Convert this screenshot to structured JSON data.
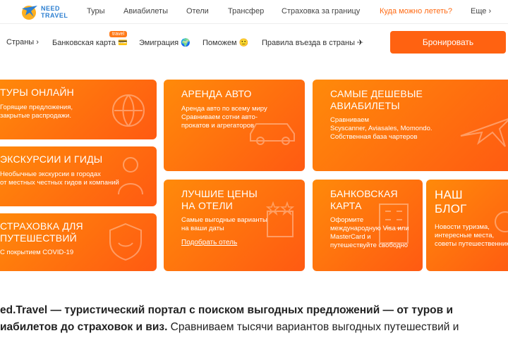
{
  "logo": {
    "text_line1": "NEED",
    "text_line2": "TRAVEL"
  },
  "topnav": {
    "items": [
      "Туры",
      "Авиабилеты",
      "Отели",
      "Трансфер",
      "Страховка за границу",
      "Куда можно лететь?",
      "Еще ›"
    ]
  },
  "subnav": {
    "items": [
      "Страны ›",
      "Банковская карта 💳",
      "Эмиграция 🌍",
      "Поможем 🙂",
      "Правила въезда в страны ✈"
    ],
    "badge": "travel",
    "book_button": "Бронировать"
  },
  "tiles": {
    "tours": {
      "title": "ТУРЫ ОНЛАЙН",
      "desc": "Горящие предложения,\nзакрытые распродажи."
    },
    "cars": {
      "title": "АРЕНДА АВТО",
      "desc": "Аренда авто по всему миру\nСравниваем сотни авто-\nпрокатов и агрегаторов"
    },
    "flights": {
      "title": "САМЫЕ ДЕШЕВЫЕ\nАВИАБИЛЕТЫ",
      "desc": "Сравниваем\nScyscanner, Aviasales, Momondo.\nСобственная база чартеров"
    },
    "excursions": {
      "title": "ЭКСКУРСИИ И ГИДЫ",
      "desc": "Необычные экскурсии в городах\nот местных честных гидов и компаний"
    },
    "hotels": {
      "title": "ЛУЧШИЕ ЦЕНЫ\nНА ОТЕЛИ",
      "desc": "Самые выгодные варианты\nна ваши даты",
      "link": "Подобрать отель"
    },
    "card": {
      "title": "БАНКОВСКАЯ\nКАРТА",
      "desc": "Оформите\nмеждународную Visa или\nMasterCard и\nпутешествуйте свободно"
    },
    "blog": {
      "title": "НАШ\nБЛОГ",
      "desc": "Новости туризма,\nинтересные места,\nсоветы путешественникам"
    },
    "insurance": {
      "title": "СТРАХОВКА ДЛЯ\nПУТЕШЕСТВИЙ",
      "desc": "С покрытием COVID-19"
    }
  },
  "intro": {
    "line1": "ed.Travel — туристический портал с поиском выгодных предложений — от туров и",
    "line2_bold": "иабилетов до страховок и виз.",
    "line2_rest": " Сравниваем тысячи вариантов выгодных путешествий и"
  },
  "colors": {
    "accent": "#ff6211",
    "tile_start": "#ff8a0a",
    "tile_end": "#ff5a12",
    "logo": "#2c7fd1"
  }
}
